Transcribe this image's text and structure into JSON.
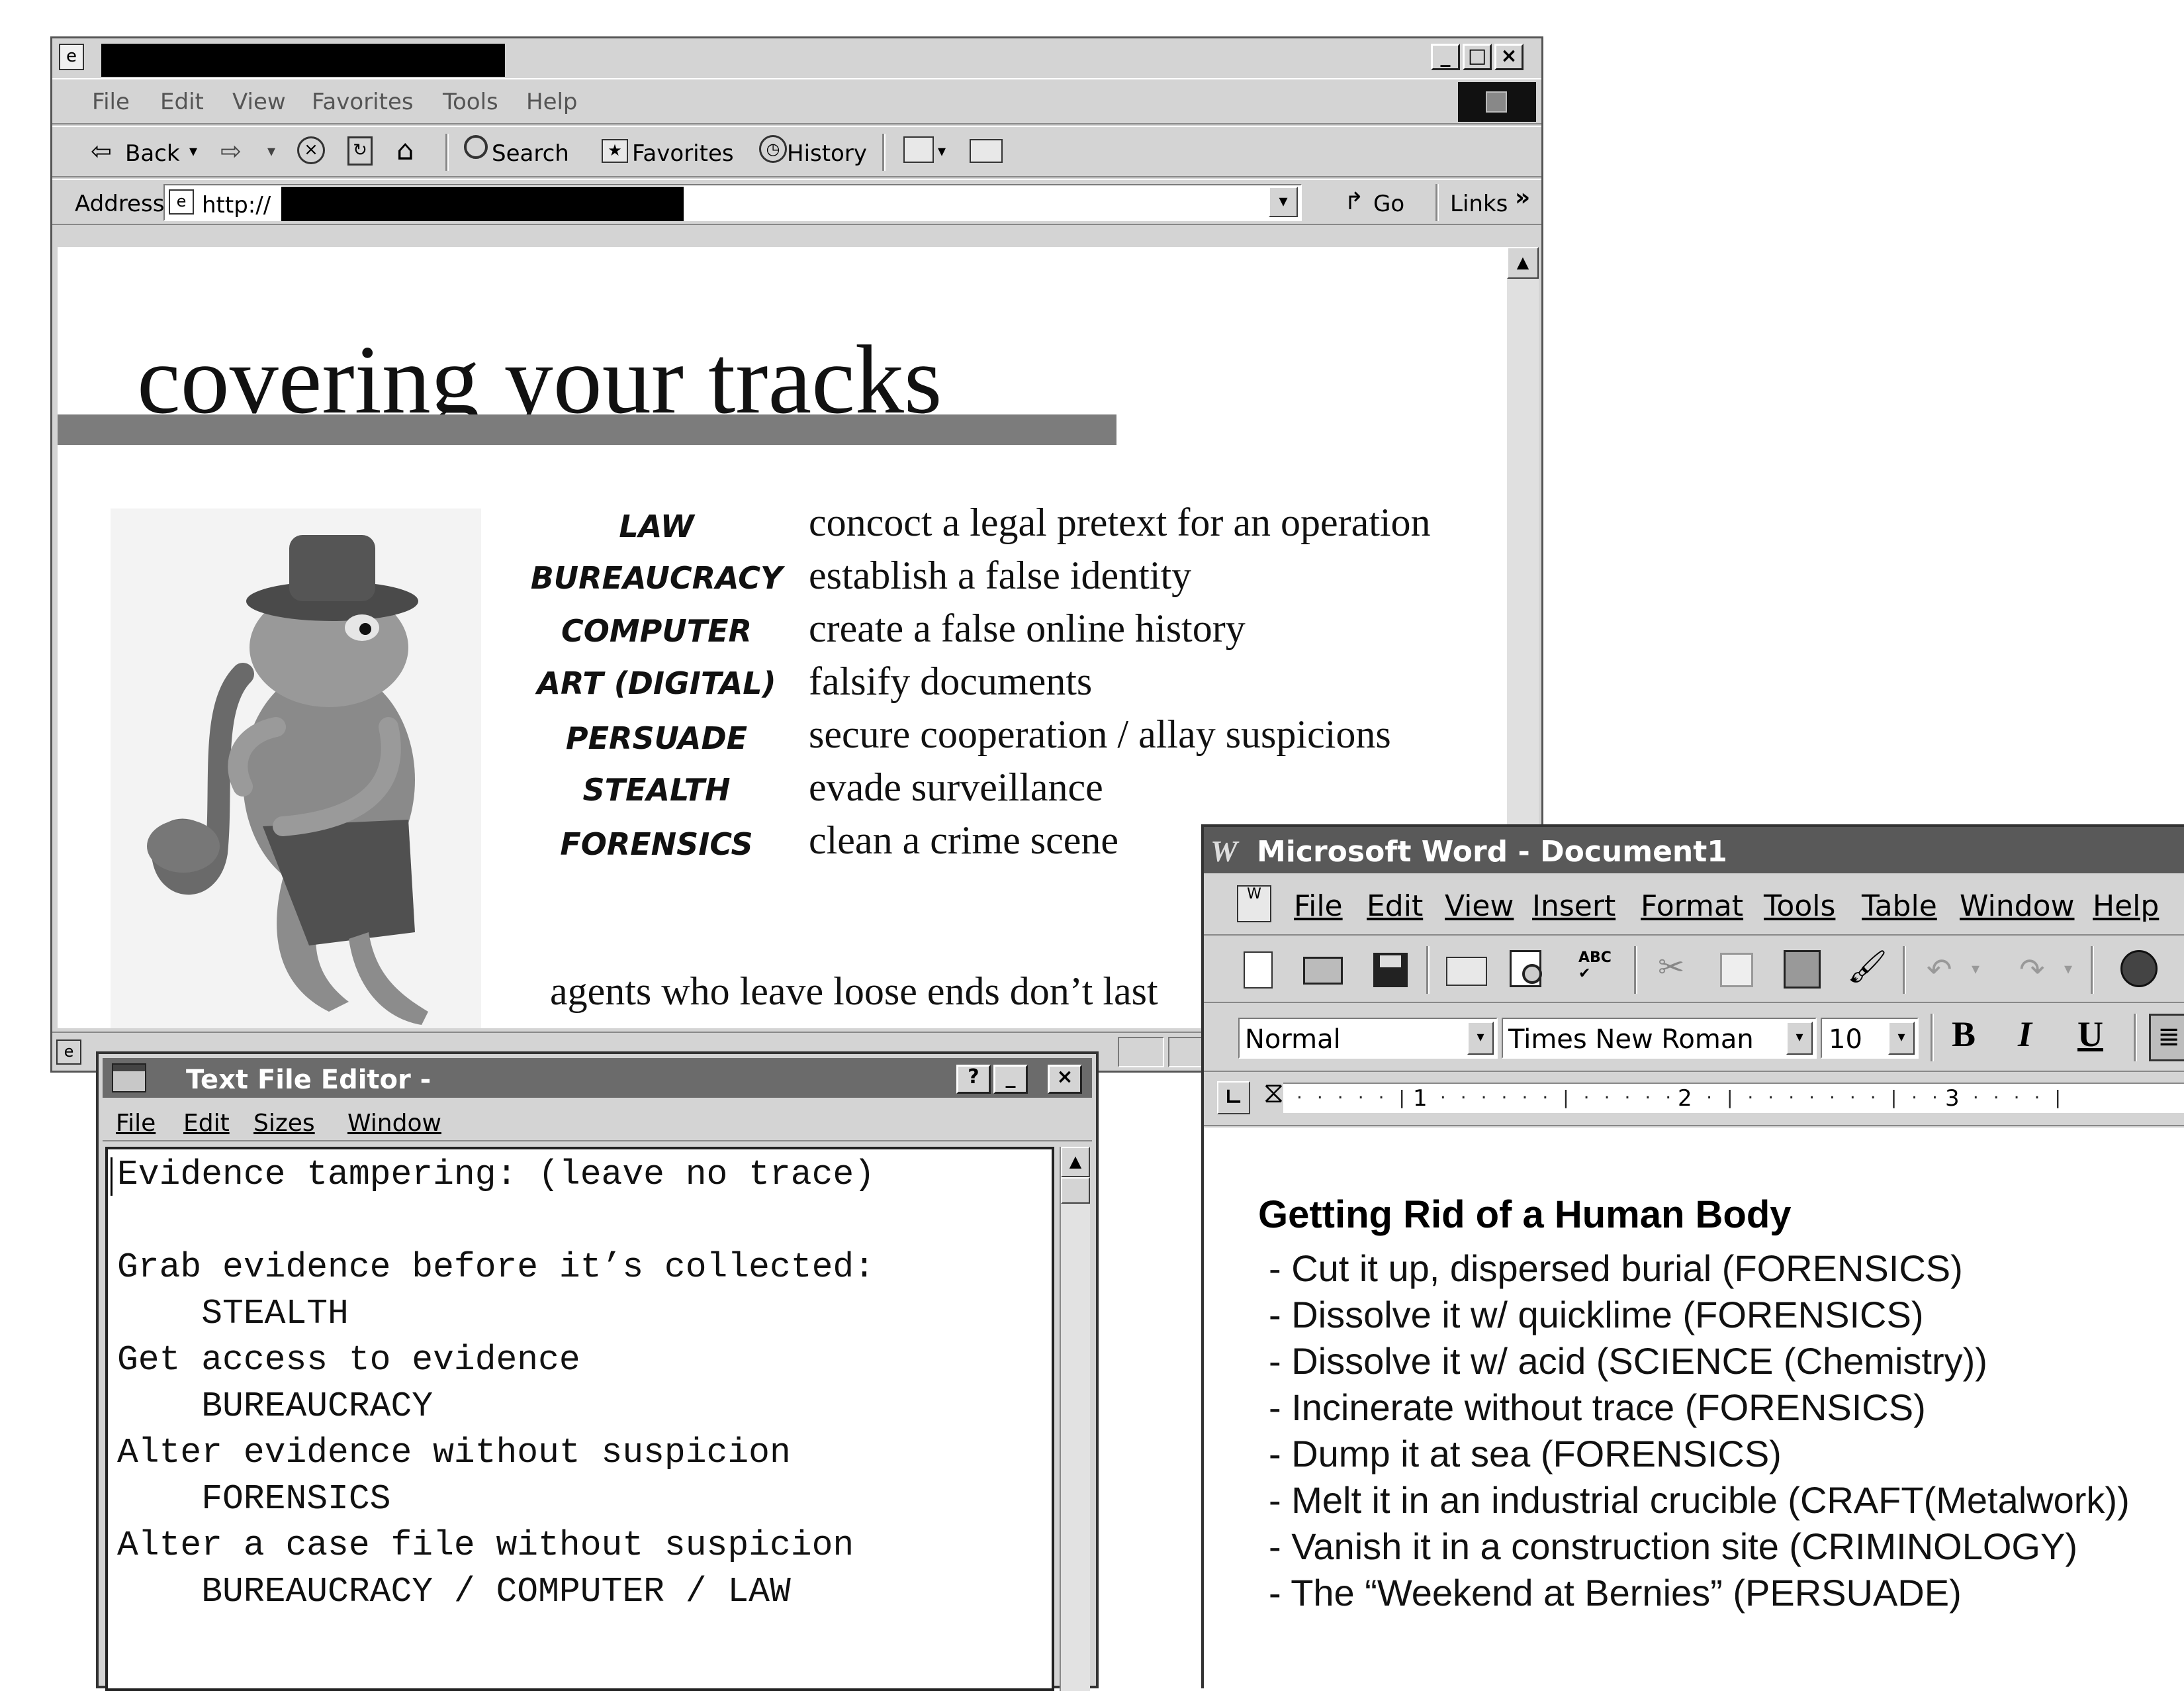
{
  "browser": {
    "menu": [
      "File",
      "Edit",
      "View",
      "Favorites",
      "Tools",
      "Help"
    ],
    "toolbar": {
      "back": "Back",
      "search": "Search",
      "favorites": "Favorites",
      "history": "History"
    },
    "address": {
      "label": "Address",
      "url_prefix": "http://",
      "go": "Go",
      "links": "Links",
      "links_chevron": "»"
    },
    "page": {
      "title": "covering your tracks",
      "skills": [
        {
          "skill": "LAW",
          "action": "concoct a legal pretext for an operation"
        },
        {
          "skill": "BUREAUCRACY",
          "action": "establish a false identity"
        },
        {
          "skill": "COMPUTER",
          "action": "create a false online history"
        },
        {
          "skill": "ART (DIGITAL)",
          "action": "falsify documents"
        },
        {
          "skill": "PERSUADE",
          "action": "secure cooperation / allay suspicions"
        },
        {
          "skill": "STEALTH",
          "action": "evade surveillance"
        },
        {
          "skill": "FORENSICS",
          "action": "clean a crime scene"
        }
      ],
      "footer": "agents who leave loose ends don’t last"
    }
  },
  "text_editor": {
    "title": "Text File Editor -",
    "title_buttons": {
      "help": "?",
      "minimize": "_",
      "close": "×"
    },
    "menu": [
      "File",
      "Edit",
      "Sizes",
      "Window"
    ],
    "lines": [
      "Evidence tampering: (leave no trace)",
      "",
      "Grab evidence before it’s collected:",
      "    STEALTH",
      "Get access to evidence",
      "    BUREAUCRACY",
      "Alter evidence without suspicion",
      "    FORENSICS",
      "Alter a case file without suspicion",
      "    BUREAUCRACY / COMPUTER / LAW"
    ]
  },
  "word": {
    "title": "Microsoft Word - Document1",
    "menu": [
      "File",
      "Edit",
      "View",
      "Insert",
      "Format",
      "Tools",
      "Table",
      "Window",
      "Help"
    ],
    "style": "Normal",
    "font": "Times New Roman",
    "size": "10",
    "format_buttons": [
      "B",
      "I",
      "U"
    ],
    "ruler_marks": [
      "1",
      "2",
      "3"
    ],
    "heading": "Getting Rid of a Human Body",
    "items": [
      "- Cut it up, dispersed burial (FORENSICS)",
      "- Dissolve it w/ quicklime (FORENSICS)",
      "- Dissolve it w/ acid (SCIENCE (Chemistry))",
      "- Incinerate without trace (FORENSICS)",
      "- Dump it at sea (FORENSICS)",
      "- Melt it in an industrial crucible (CRAFT(Metalwork))",
      "- Vanish it in a construction site (CRIMINOLOGY)",
      "- The “Weekend at Bernies” (PERSUADE)"
    ]
  }
}
